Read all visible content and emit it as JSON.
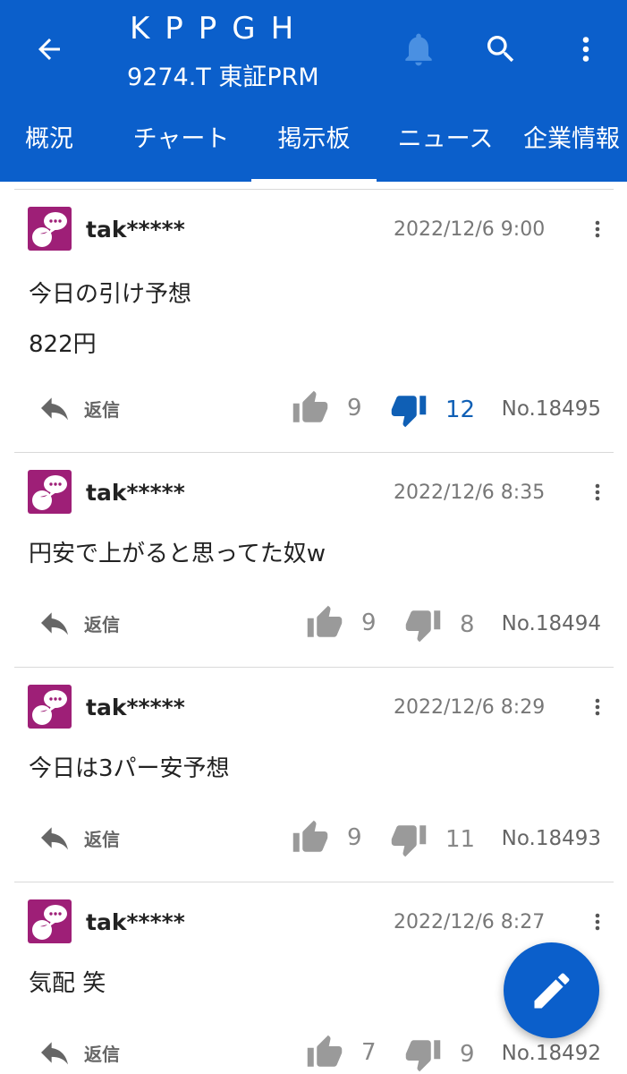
{
  "header": {
    "title": "KPPGH",
    "subtitle": "9274.T 東証PRM",
    "colors": {
      "bar": "#0b5fcb",
      "bell": "#4a90e2",
      "icon": "#ffffff"
    }
  },
  "tabs": [
    {
      "label": "概況",
      "active": false
    },
    {
      "label": "チャート",
      "active": false
    },
    {
      "label": "掲示板",
      "active": true
    },
    {
      "label": "ニュース",
      "active": false
    },
    {
      "label": "企業情報",
      "active": false
    }
  ],
  "posts": [
    {
      "user": "tak*****",
      "date": "2022/12/6 9:00",
      "lines": [
        "今日の引け予想",
        "822円"
      ],
      "reply_label": "返信",
      "likes": "9",
      "dislikes": "12",
      "dislike_active": true,
      "number": "No.18495"
    },
    {
      "user": "tak*****",
      "date": "2022/12/6 8:35",
      "lines": [
        "円安で上がると思ってた奴w"
      ],
      "reply_label": "返信",
      "likes": "9",
      "dislikes": "8",
      "dislike_active": false,
      "number": "No.18494"
    },
    {
      "user": "tak*****",
      "date": "2022/12/6 8:29",
      "lines": [
        "今日は3パー安予想"
      ],
      "reply_label": "返信",
      "likes": "9",
      "dislikes": "11",
      "dislike_active": false,
      "number": "No.18493"
    },
    {
      "user": "tak*****",
      "date": "2022/12/6 8:27",
      "lines": [
        "気配 笑"
      ],
      "reply_label": "返信",
      "likes": "7",
      "dislikes": "9",
      "dislike_active": false,
      "number": "No.18492"
    }
  ],
  "colors": {
    "avatar": "#9e1f77",
    "active_vote": "#0f5fb5",
    "fab": "#0b5fcb"
  }
}
